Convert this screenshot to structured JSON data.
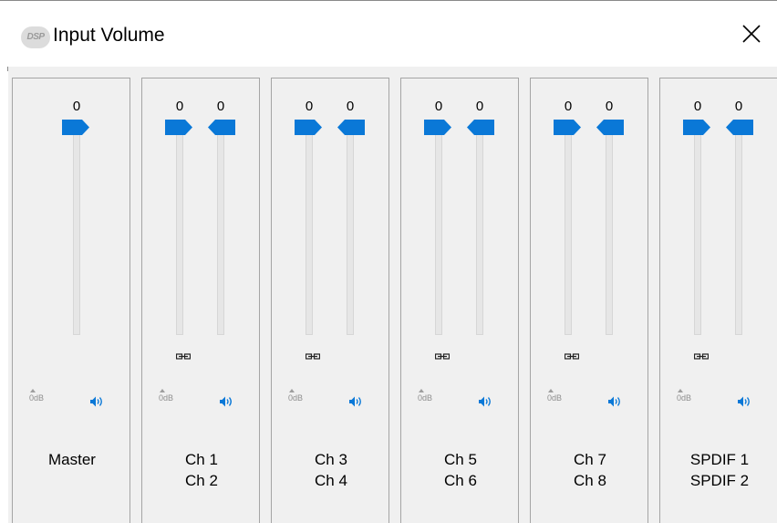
{
  "window": {
    "title": "Input Volume",
    "logo_text": "DSP"
  },
  "strips": [
    {
      "name_line1": "Master",
      "name_line2": "",
      "values": [
        "0"
      ],
      "zero_db_label": "0dB",
      "levels": [
        1.0
      ]
    },
    {
      "name_line1": "Ch 1",
      "name_line2": "Ch 2",
      "values": [
        "0",
        "0"
      ],
      "zero_db_label": "0dB",
      "levels": [
        1.0,
        1.0
      ]
    },
    {
      "name_line1": "Ch 3",
      "name_line2": "Ch 4",
      "values": [
        "0",
        "0"
      ],
      "zero_db_label": "0dB",
      "levels": [
        1.0,
        1.0
      ]
    },
    {
      "name_line1": "Ch 5",
      "name_line2": "Ch 6",
      "values": [
        "0",
        "0"
      ],
      "zero_db_label": "0dB",
      "levels": [
        1.0,
        1.0
      ]
    },
    {
      "name_line1": "Ch 7",
      "name_line2": "Ch 8",
      "values": [
        "0",
        "0"
      ],
      "zero_db_label": "0dB",
      "levels": [
        1.0,
        1.0
      ]
    },
    {
      "name_line1": "SPDIF 1",
      "name_line2": "SPDIF 2",
      "values": [
        "0",
        "0"
      ],
      "zero_db_label": "0dB",
      "levels": [
        1.0,
        1.0
      ]
    }
  ],
  "icons": {
    "close": "close-icon",
    "link": "link-icon",
    "speaker": "speaker-icon",
    "zero_db_marker": "caret-up-icon"
  },
  "colors": {
    "thumb": "#0a78d7",
    "panel_bg": "#f0f0f0",
    "speaker": "#0a78d7"
  }
}
